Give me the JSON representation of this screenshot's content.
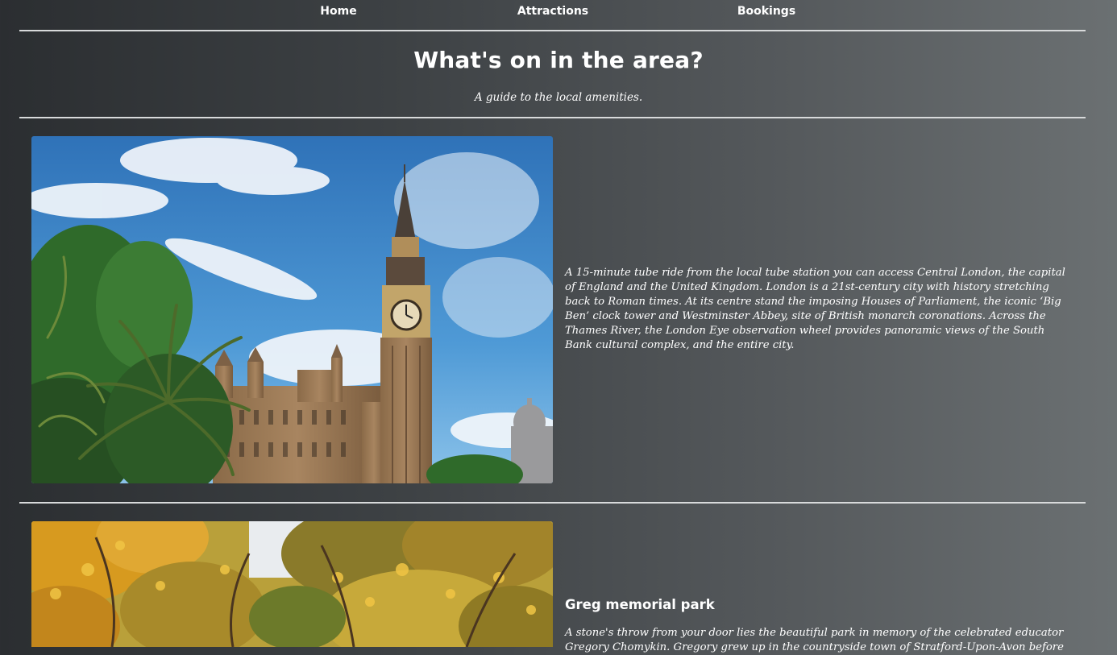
{
  "nav": {
    "items": [
      {
        "label": "Home"
      },
      {
        "label": "Attractions"
      },
      {
        "label": "Bookings"
      }
    ]
  },
  "header": {
    "title": "What's on in the area?",
    "subtitle": "A guide to the local amenities."
  },
  "sections": [
    {
      "heading": "",
      "description": "A 15-minute tube ride from the local tube station you can access Central London, the capital of England and the United Kingdom. London is a 21st-century city with history stretching back to Roman times. At its centre stand the imposing Houses of Parliament, the iconic ‘Big Ben’ clock tower and Westminster Abbey, site of British monarch coronations. Across the Thames River, the London Eye observation wheel provides panoramic views of the South Bank cultural complex, and the entire city."
    },
    {
      "heading": "Greg memorial park",
      "description": "A stone's throw from your door lies the beautiful park in memory of the celebrated educator Gregory Chomykin. Gregory grew up in the countryside town of Stratford-Upon-Avon before"
    }
  ],
  "colors": {
    "background_start": "#2b2e31",
    "background_end": "#6b7072",
    "text": "#ffffff",
    "rule": "#d8dadb"
  }
}
